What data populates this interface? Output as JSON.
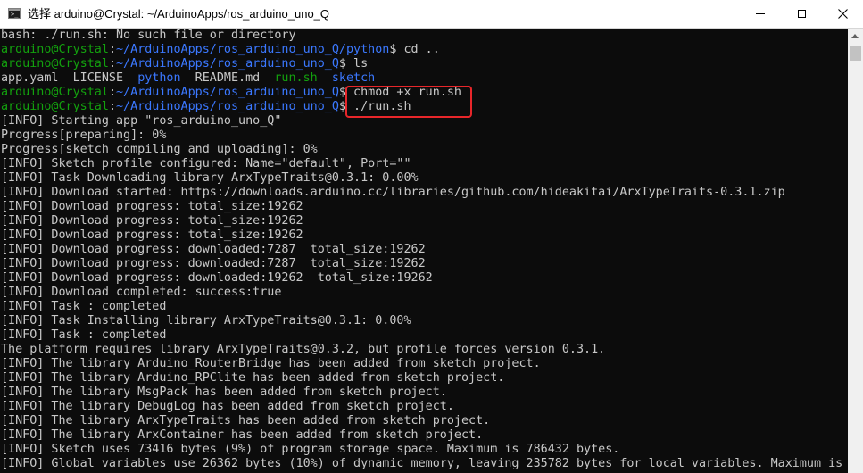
{
  "window": {
    "title": "选择 arduino@Crystal: ~/ArduinoApps/ros_arduino_uno_Q",
    "buttons": {
      "minimize": "minimize",
      "maximize": "maximize",
      "close": "✕"
    }
  },
  "colors": {
    "user": "#13a10e",
    "path": "#3b78ff",
    "text": "#c8c8c8",
    "highlight": "#e8262a"
  },
  "terminal": {
    "lines": [
      {
        "segments": [
          {
            "c": "plain",
            "t": "bash: ./run.sh: No such file or directory"
          }
        ]
      },
      {
        "segments": [
          {
            "c": "user",
            "t": "arduino@Crystal"
          },
          {
            "c": "plain",
            "t": ":"
          },
          {
            "c": "path",
            "t": "~/ArduinoApps/ros_arduino_uno_Q/python"
          },
          {
            "c": "plain",
            "t": "$ cd .."
          }
        ]
      },
      {
        "segments": [
          {
            "c": "user",
            "t": "arduino@Crystal"
          },
          {
            "c": "plain",
            "t": ":"
          },
          {
            "c": "path",
            "t": "~/ArduinoApps/ros_arduino_uno_Q"
          },
          {
            "c": "plain",
            "t": "$ ls"
          }
        ]
      },
      {
        "segments": [
          {
            "c": "plain",
            "t": "app.yaml  LICENSE  "
          },
          {
            "c": "path",
            "t": "python"
          },
          {
            "c": "plain",
            "t": "  README.md  "
          },
          {
            "c": "user",
            "t": "run.sh"
          },
          {
            "c": "plain",
            "t": "  "
          },
          {
            "c": "path",
            "t": "sketch"
          }
        ]
      },
      {
        "segments": [
          {
            "c": "user",
            "t": "arduino@Crystal"
          },
          {
            "c": "plain",
            "t": ":"
          },
          {
            "c": "path",
            "t": "~/ArduinoApps/ros_arduino_uno_Q"
          },
          {
            "c": "plain",
            "t": "$ chmod +x run.sh"
          }
        ]
      },
      {
        "segments": [
          {
            "c": "user",
            "t": "arduino@Crystal"
          },
          {
            "c": "plain",
            "t": ":"
          },
          {
            "c": "path",
            "t": "~/ArduinoApps/ros_arduino_uno_Q"
          },
          {
            "c": "plain",
            "t": "$ ./run.sh"
          }
        ]
      },
      {
        "segments": [
          {
            "c": "plain",
            "t": "[INFO] Starting app \"ros_arduino_uno_Q\""
          }
        ]
      },
      {
        "segments": [
          {
            "c": "plain",
            "t": "Progress[preparing]: 0%"
          }
        ]
      },
      {
        "segments": [
          {
            "c": "plain",
            "t": "Progress[sketch compiling and uploading]: 0%"
          }
        ]
      },
      {
        "segments": [
          {
            "c": "plain",
            "t": "[INFO] Sketch profile configured: Name=\"default\", Port=\"\""
          }
        ]
      },
      {
        "segments": [
          {
            "c": "plain",
            "t": "[INFO] Task Downloading library ArxTypeTraits@0.3.1: 0.00%"
          }
        ]
      },
      {
        "segments": [
          {
            "c": "plain",
            "t": "[INFO] Download started: https://downloads.arduino.cc/libraries/github.com/hideakitai/ArxTypeTraits-0.3.1.zip"
          }
        ]
      },
      {
        "segments": [
          {
            "c": "plain",
            "t": "[INFO] Download progress: total_size:19262"
          }
        ]
      },
      {
        "segments": [
          {
            "c": "plain",
            "t": "[INFO] Download progress: total_size:19262"
          }
        ]
      },
      {
        "segments": [
          {
            "c": "plain",
            "t": "[INFO] Download progress: total_size:19262"
          }
        ]
      },
      {
        "segments": [
          {
            "c": "plain",
            "t": "[INFO] Download progress: downloaded:7287  total_size:19262"
          }
        ]
      },
      {
        "segments": [
          {
            "c": "plain",
            "t": "[INFO] Download progress: downloaded:7287  total_size:19262"
          }
        ]
      },
      {
        "segments": [
          {
            "c": "plain",
            "t": "[INFO] Download progress: downloaded:19262  total_size:19262"
          }
        ]
      },
      {
        "segments": [
          {
            "c": "plain",
            "t": "[INFO] Download completed: success:true"
          }
        ]
      },
      {
        "segments": [
          {
            "c": "plain",
            "t": "[INFO] Task : completed"
          }
        ]
      },
      {
        "segments": [
          {
            "c": "plain",
            "t": "[INFO] Task Installing library ArxTypeTraits@0.3.1: 0.00%"
          }
        ]
      },
      {
        "segments": [
          {
            "c": "plain",
            "t": "[INFO] Task : completed"
          }
        ]
      },
      {
        "segments": [
          {
            "c": "plain",
            "t": "The platform requires library ArxTypeTraits@0.3.2, but profile forces version 0.3.1."
          }
        ]
      },
      {
        "segments": [
          {
            "c": "plain",
            "t": "[INFO] The library Arduino_RouterBridge has been added from sketch project."
          }
        ]
      },
      {
        "segments": [
          {
            "c": "plain",
            "t": "[INFO] The library Arduino_RPClite has been added from sketch project."
          }
        ]
      },
      {
        "segments": [
          {
            "c": "plain",
            "t": "[INFO] The library MsgPack has been added from sketch project."
          }
        ]
      },
      {
        "segments": [
          {
            "c": "plain",
            "t": "[INFO] The library DebugLog has been added from sketch project."
          }
        ]
      },
      {
        "segments": [
          {
            "c": "plain",
            "t": "[INFO] The library ArxTypeTraits has been added from sketch project."
          }
        ]
      },
      {
        "segments": [
          {
            "c": "plain",
            "t": "[INFO] The library ArxContainer has been added from sketch project."
          }
        ]
      },
      {
        "segments": [
          {
            "c": "plain",
            "t": "[INFO] Sketch uses 73416 bytes (9%) of program storage space. Maximum is 786432 bytes."
          }
        ]
      },
      {
        "segments": [
          {
            "c": "plain",
            "t": "[INFO] Global variables use 26362 bytes (10%) of dynamic memory, leaving 235782 bytes for local variables. Maximum is"
          }
        ]
      }
    ]
  }
}
